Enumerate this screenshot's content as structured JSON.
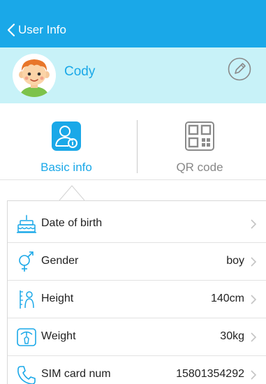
{
  "nav": {
    "back_label": "User Info"
  },
  "profile": {
    "name": "Cody"
  },
  "tabs": [
    {
      "label": "Basic info",
      "active": true
    },
    {
      "label": "QR code",
      "active": false
    }
  ],
  "rows": [
    {
      "label": "Date of birth",
      "value": "",
      "icon": "cake-icon"
    },
    {
      "label": "Gender",
      "value": "boy",
      "icon": "gender-icon"
    },
    {
      "label": "Height",
      "value": "140cm",
      "icon": "height-icon"
    },
    {
      "label": "Weight",
      "value": "30kg",
      "icon": "scale-icon"
    },
    {
      "label": "SIM card num",
      "value": "15801354292",
      "icon": "phone-icon"
    }
  ],
  "colors": {
    "accent": "#1aa8e8",
    "profile_band": "#c8f2f8",
    "muted": "#888888"
  }
}
